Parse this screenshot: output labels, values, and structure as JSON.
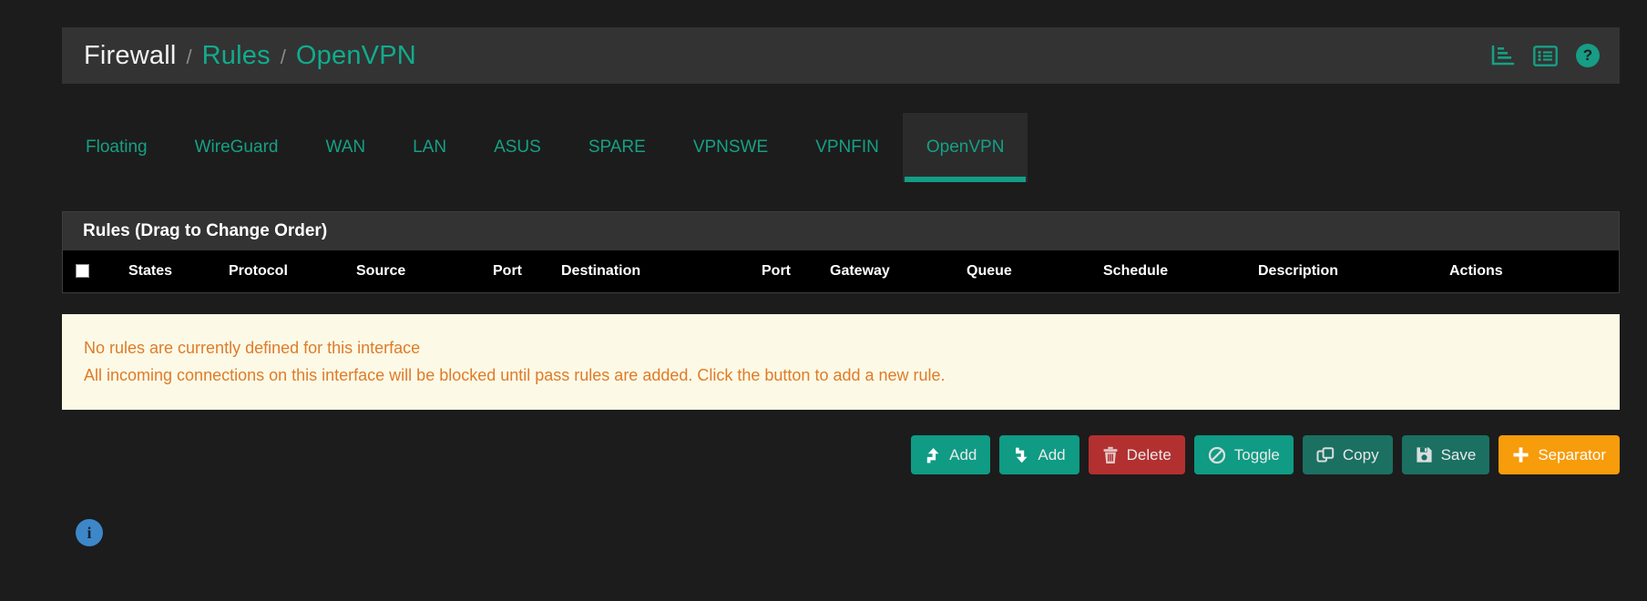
{
  "header": {
    "crumb_root": "Firewall",
    "separator": "/",
    "crumb_rules": "Rules",
    "crumb_current": "OpenVPN",
    "icons": {
      "stats": "stats-chart-icon",
      "list": "list-table-icon",
      "help": "?"
    }
  },
  "tabs": [
    {
      "label": "Floating",
      "active": false
    },
    {
      "label": "WireGuard",
      "active": false
    },
    {
      "label": "WAN",
      "active": false
    },
    {
      "label": "LAN",
      "active": false
    },
    {
      "label": "ASUS",
      "active": false
    },
    {
      "label": "SPARE",
      "active": false
    },
    {
      "label": "VPNSWE",
      "active": false
    },
    {
      "label": "VPNFIN",
      "active": false
    },
    {
      "label": "OpenVPN",
      "active": true
    }
  ],
  "panel": {
    "title": "Rules (Drag to Change Order)",
    "columns": [
      "States",
      "Protocol",
      "Source",
      "Port",
      "Destination",
      "Port",
      "Gateway",
      "Queue",
      "Schedule",
      "Description",
      "Actions"
    ]
  },
  "alert": {
    "line1": "No rules are currently defined for this interface",
    "line2": "All incoming connections on this interface will be blocked until pass rules are added. Click the button to add a new rule."
  },
  "buttons": [
    {
      "label": "Add",
      "icon": "arrow-up-icon",
      "style": "teal"
    },
    {
      "label": "Add",
      "icon": "arrow-down-icon",
      "style": "teal"
    },
    {
      "label": "Delete",
      "icon": "trash-icon",
      "style": "red"
    },
    {
      "label": "Toggle",
      "icon": "ban-icon",
      "style": "teal"
    },
    {
      "label": "Copy",
      "icon": "copy-icon",
      "style": "dteal"
    },
    {
      "label": "Save",
      "icon": "save-icon",
      "style": "dteal"
    },
    {
      "label": "Separator",
      "icon": "plus-icon",
      "style": "orange"
    }
  ],
  "footer": {
    "info_label": "i"
  },
  "colors": {
    "page_bg": "#1c1c1c",
    "panel_bg": "#2b2b2b",
    "header_bg": "#333333",
    "accent_teal": "#15a085",
    "button_teal": "#0f9b84",
    "button_dark_teal": "#1b7062",
    "button_red": "#b33030",
    "button_orange": "#f79c0b",
    "alert_bg": "#fcfae6",
    "alert_text": "#e07b29",
    "info_blue": "#3d87c9"
  }
}
